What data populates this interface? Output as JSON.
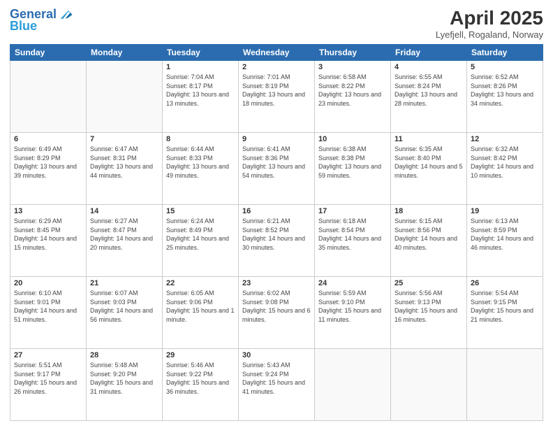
{
  "header": {
    "logo_line1": "General",
    "logo_line2": "Blue",
    "title": "April 2025",
    "subtitle": "Lyefjell, Rogaland, Norway"
  },
  "weekdays": [
    "Sunday",
    "Monday",
    "Tuesday",
    "Wednesday",
    "Thursday",
    "Friday",
    "Saturday"
  ],
  "weeks": [
    [
      {
        "day": "",
        "info": ""
      },
      {
        "day": "",
        "info": ""
      },
      {
        "day": "1",
        "info": "Sunrise: 7:04 AM\nSunset: 8:17 PM\nDaylight: 13 hours and 13 minutes."
      },
      {
        "day": "2",
        "info": "Sunrise: 7:01 AM\nSunset: 8:19 PM\nDaylight: 13 hours and 18 minutes."
      },
      {
        "day": "3",
        "info": "Sunrise: 6:58 AM\nSunset: 8:22 PM\nDaylight: 13 hours and 23 minutes."
      },
      {
        "day": "4",
        "info": "Sunrise: 6:55 AM\nSunset: 8:24 PM\nDaylight: 13 hours and 28 minutes."
      },
      {
        "day": "5",
        "info": "Sunrise: 6:52 AM\nSunset: 8:26 PM\nDaylight: 13 hours and 34 minutes."
      }
    ],
    [
      {
        "day": "6",
        "info": "Sunrise: 6:49 AM\nSunset: 8:29 PM\nDaylight: 13 hours and 39 minutes."
      },
      {
        "day": "7",
        "info": "Sunrise: 6:47 AM\nSunset: 8:31 PM\nDaylight: 13 hours and 44 minutes."
      },
      {
        "day": "8",
        "info": "Sunrise: 6:44 AM\nSunset: 8:33 PM\nDaylight: 13 hours and 49 minutes."
      },
      {
        "day": "9",
        "info": "Sunrise: 6:41 AM\nSunset: 8:36 PM\nDaylight: 13 hours and 54 minutes."
      },
      {
        "day": "10",
        "info": "Sunrise: 6:38 AM\nSunset: 8:38 PM\nDaylight: 13 hours and 59 minutes."
      },
      {
        "day": "11",
        "info": "Sunrise: 6:35 AM\nSunset: 8:40 PM\nDaylight: 14 hours and 5 minutes."
      },
      {
        "day": "12",
        "info": "Sunrise: 6:32 AM\nSunset: 8:42 PM\nDaylight: 14 hours and 10 minutes."
      }
    ],
    [
      {
        "day": "13",
        "info": "Sunrise: 6:29 AM\nSunset: 8:45 PM\nDaylight: 14 hours and 15 minutes."
      },
      {
        "day": "14",
        "info": "Sunrise: 6:27 AM\nSunset: 8:47 PM\nDaylight: 14 hours and 20 minutes."
      },
      {
        "day": "15",
        "info": "Sunrise: 6:24 AM\nSunset: 8:49 PM\nDaylight: 14 hours and 25 minutes."
      },
      {
        "day": "16",
        "info": "Sunrise: 6:21 AM\nSunset: 8:52 PM\nDaylight: 14 hours and 30 minutes."
      },
      {
        "day": "17",
        "info": "Sunrise: 6:18 AM\nSunset: 8:54 PM\nDaylight: 14 hours and 35 minutes."
      },
      {
        "day": "18",
        "info": "Sunrise: 6:15 AM\nSunset: 8:56 PM\nDaylight: 14 hours and 40 minutes."
      },
      {
        "day": "19",
        "info": "Sunrise: 6:13 AM\nSunset: 8:59 PM\nDaylight: 14 hours and 46 minutes."
      }
    ],
    [
      {
        "day": "20",
        "info": "Sunrise: 6:10 AM\nSunset: 9:01 PM\nDaylight: 14 hours and 51 minutes."
      },
      {
        "day": "21",
        "info": "Sunrise: 6:07 AM\nSunset: 9:03 PM\nDaylight: 14 hours and 56 minutes."
      },
      {
        "day": "22",
        "info": "Sunrise: 6:05 AM\nSunset: 9:06 PM\nDaylight: 15 hours and 1 minute."
      },
      {
        "day": "23",
        "info": "Sunrise: 6:02 AM\nSunset: 9:08 PM\nDaylight: 15 hours and 6 minutes."
      },
      {
        "day": "24",
        "info": "Sunrise: 5:59 AM\nSunset: 9:10 PM\nDaylight: 15 hours and 11 minutes."
      },
      {
        "day": "25",
        "info": "Sunrise: 5:56 AM\nSunset: 9:13 PM\nDaylight: 15 hours and 16 minutes."
      },
      {
        "day": "26",
        "info": "Sunrise: 5:54 AM\nSunset: 9:15 PM\nDaylight: 15 hours and 21 minutes."
      }
    ],
    [
      {
        "day": "27",
        "info": "Sunrise: 5:51 AM\nSunset: 9:17 PM\nDaylight: 15 hours and 26 minutes."
      },
      {
        "day": "28",
        "info": "Sunrise: 5:48 AM\nSunset: 9:20 PM\nDaylight: 15 hours and 31 minutes."
      },
      {
        "day": "29",
        "info": "Sunrise: 5:46 AM\nSunset: 9:22 PM\nDaylight: 15 hours and 36 minutes."
      },
      {
        "day": "30",
        "info": "Sunrise: 5:43 AM\nSunset: 9:24 PM\nDaylight: 15 hours and 41 minutes."
      },
      {
        "day": "",
        "info": ""
      },
      {
        "day": "",
        "info": ""
      },
      {
        "day": "",
        "info": ""
      }
    ]
  ]
}
